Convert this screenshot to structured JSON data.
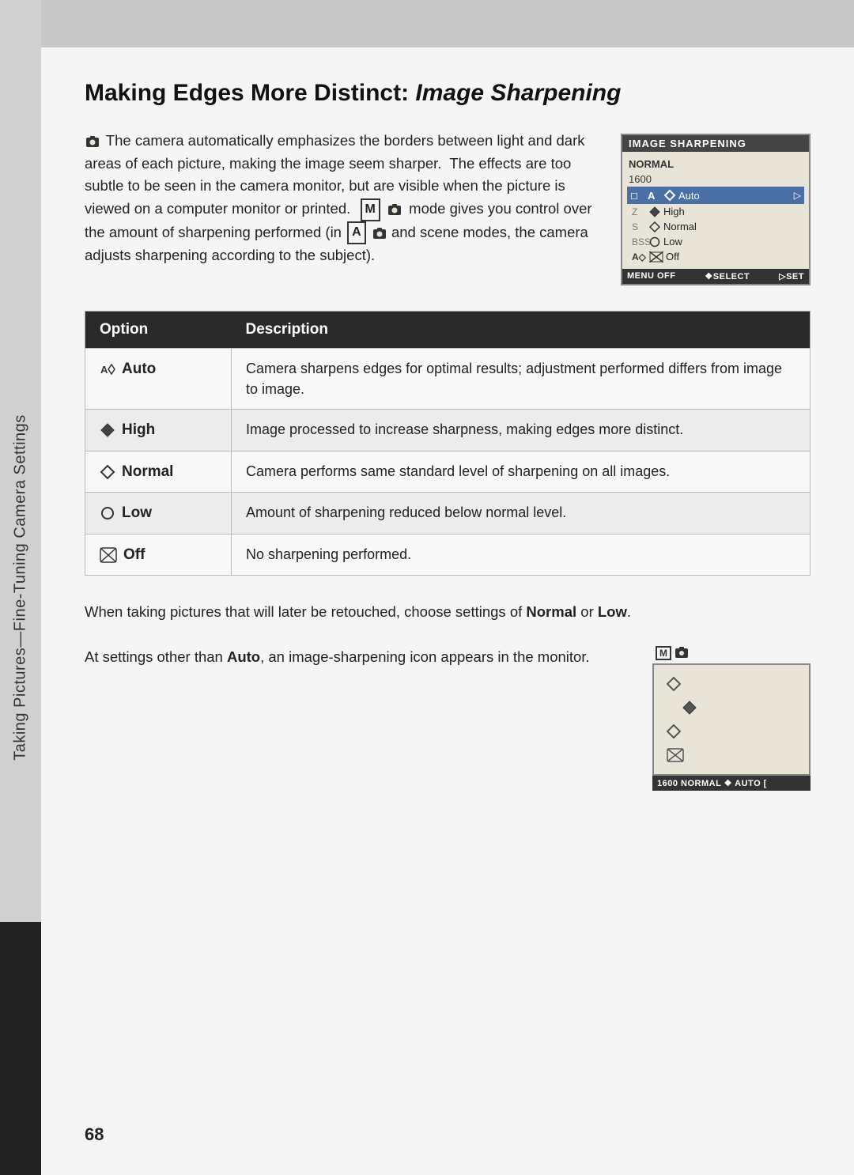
{
  "page": {
    "number": "68",
    "sidebar_text": "Taking Pictures—Fine-Tuning Camera Settings"
  },
  "title": {
    "main": "Making Edges More Distinct: ",
    "italic": "Image Sharpening"
  },
  "intro": {
    "paragraph": "The camera automatically emphasizes the borders between light and dark areas of each picture, making the image seem sharper.  The effects are too subtle to be seen in the camera monitor, but are visible when the picture is viewed on a computer monitor or printed.   mode gives you control over the amount of sharpening performed (in   and scene modes, the camera adjusts sharpening according to the subject)."
  },
  "camera_screen": {
    "title": "IMAGE SHARPENING",
    "rows": [
      {
        "label": "NORMAL",
        "col": "",
        "icon": "A◇",
        "text": "Auto",
        "arrow": "▷",
        "selected": false
      },
      {
        "label": "1600",
        "col": "",
        "icon": "",
        "text": "",
        "arrow": "",
        "selected": false
      },
      {
        "label": "◻",
        "col": "A",
        "icon": "A◇",
        "text": "Auto",
        "arrow": "▷",
        "selected": true
      },
      {
        "label": "",
        "col": "Z",
        "icon": "◆",
        "text": "High",
        "arrow": "",
        "selected": false
      },
      {
        "label": "",
        "col": "S",
        "icon": "◇",
        "text": "Normal",
        "arrow": "",
        "selected": false
      },
      {
        "label": "",
        "col": "BSS",
        "icon": "○",
        "text": "Low",
        "arrow": "",
        "selected": false
      },
      {
        "label": "",
        "col": "A◇",
        "icon": "⊘",
        "text": "Off",
        "arrow": "",
        "selected": false
      }
    ],
    "bottom": {
      "menu": "MENU OFF",
      "select": "❖SELECT",
      "set": "▷SET"
    }
  },
  "table": {
    "headers": [
      "Option",
      "Description"
    ],
    "rows": [
      {
        "option_icon": "A◇",
        "option_label": "Auto",
        "description": "Camera sharpens edges for optimal results; adjustment performed differs from image to image."
      },
      {
        "option_icon": "◆",
        "option_label": "High",
        "description": "Image processed to increase sharpness, making edges more distinct."
      },
      {
        "option_icon": "◇",
        "option_label": "Normal",
        "description": "Camera performs same standard level of sharpening on all images."
      },
      {
        "option_icon": "○",
        "option_label": "Low",
        "description": "Amount of sharpening reduced below normal level."
      },
      {
        "option_icon": "⊘",
        "option_label": "Off",
        "description": "No sharpening performed."
      }
    ]
  },
  "bottom_paragraph": "When taking pictures that will later be retouched, choose settings of Normal or Low.",
  "bottom_paragraph2_before": "At settings other than ",
  "bottom_paragraph2_bold": "Auto",
  "bottom_paragraph2_after": ", an image-sharpening icon appears in the monitor.",
  "camera_screen2": {
    "mode": "M◻",
    "icons": [
      "◇",
      "◇",
      "◇",
      "⊘"
    ],
    "selected_index": 1,
    "bottom_bar": "1600 NORMAL ❖ AUTO    ["
  }
}
